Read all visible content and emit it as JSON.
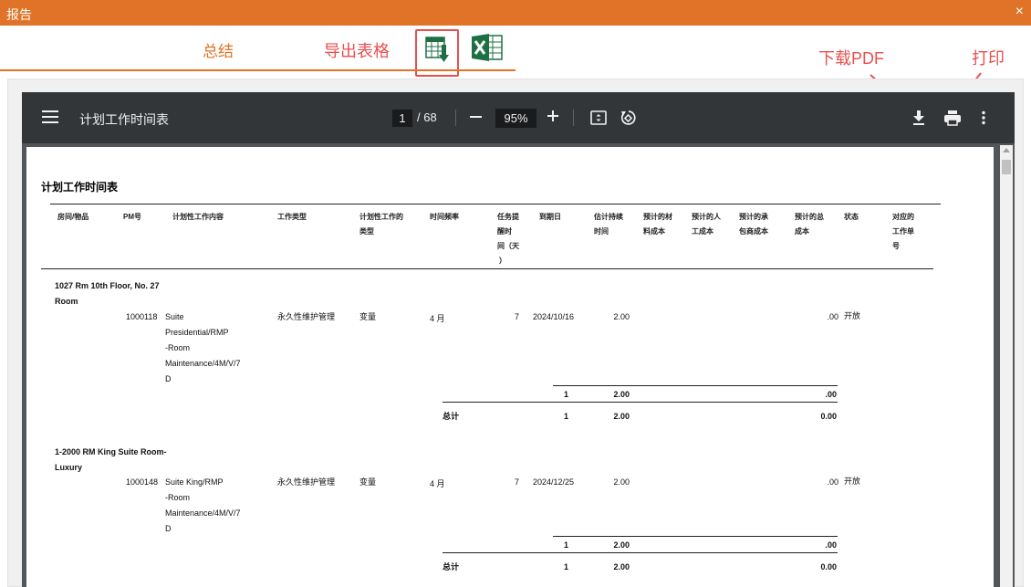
{
  "window": {
    "title": "报告",
    "close": "×"
  },
  "tabs": {
    "summary": "总结",
    "export": "导出表格"
  },
  "annotations": {
    "download": "下载PDF",
    "print": "打印"
  },
  "colors": {
    "accent": "#e07328",
    "highlight": "#e85050",
    "toolbar": "#323639",
    "excel_green": "#1d7044"
  },
  "icons": [
    "spreadsheet-export-icon",
    "excel-icon",
    "menu-icon",
    "fit-page-icon",
    "rotate-icon",
    "download-icon",
    "print-icon",
    "more-icon"
  ],
  "viewer": {
    "doc_title": "计划工作时间表",
    "page_current": "1",
    "page_total": "/ 68",
    "zoom": "95%"
  },
  "report": {
    "title": "计划工作时间表",
    "headers": {
      "room": "房间/物品",
      "pm": "PM号",
      "content": "计划性工作内容",
      "work_type": "工作类型",
      "category_1": "计划性工作的",
      "category_2": "类型",
      "frequency": "时间频率",
      "interval_1": "任务提",
      "interval_2": "醒时",
      "interval_3": "间（天",
      "interval_4": "）",
      "due": "到期日",
      "duration_1": "估计持续",
      "duration_2": "时间",
      "material_1": "预计的材",
      "material_2": "料成本",
      "labor_1": "预计的人",
      "labor_2": "工成本",
      "outsource_1": "预计的承",
      "outsource_2": "包商成本",
      "total_1": "预计的总",
      "total_2": "成本",
      "status": "状态",
      "order_1": "对应的",
      "order_2": "工作单",
      "order_3": "号"
    },
    "groups": [
      {
        "room_1": "1027 Rm 10th Floor, No. 27",
        "room_2": "Room",
        "pm": "1000118",
        "content_1": "Suite",
        "content_2": "Presidential/RMP",
        "content_3": "-Room",
        "content_4": "Maintenance/4M/V/7",
        "content_5": "D",
        "work_type": "永久性维护管理",
        "category": "变量",
        "frequency": "4 月",
        "interval": "7",
        "due": "2024/10/16",
        "duration": "2.00",
        "total_cost": ".00",
        "status": "开放",
        "sub_count": "1",
        "sub_duration": "2.00",
        "sub_cost": ".00",
        "sum_label": "总计",
        "sum_count": "1",
        "sum_duration": "2.00",
        "sum_cost": "0.00"
      },
      {
        "room_1": "1-2000 RM King Suite Room-",
        "room_2": "Luxury",
        "pm": "1000148",
        "content_1": "Suite King/RMP",
        "content_2": "-Room",
        "content_3": "Maintenance/4M/V/7",
        "content_4": "D",
        "work_type": "永久性维护管理",
        "category": "变量",
        "frequency": "4 月",
        "interval": "7",
        "due": "2024/12/25",
        "duration": "2.00",
        "total_cost": ".00",
        "status": "开放",
        "sub_count": "1",
        "sub_duration": "2.00",
        "sub_cost": ".00",
        "sum_label": "总计",
        "sum_count": "1",
        "sum_duration": "2.00",
        "sum_cost": "0.00"
      }
    ]
  }
}
